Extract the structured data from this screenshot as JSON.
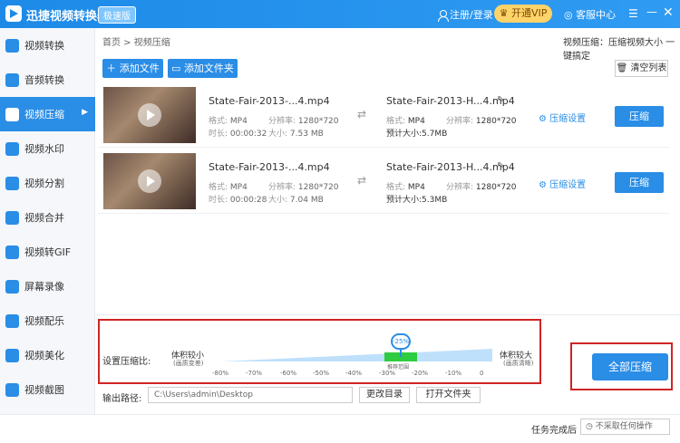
{
  "titlebar": {
    "app_title": "迅捷视频转换器",
    "edition": "极速版",
    "login": "注册/登录",
    "vip": "开通VIP",
    "service": "客服中心",
    "menu_icon": "☰",
    "minimize_icon": "—",
    "close_icon": "✕"
  },
  "sidebar": {
    "items": [
      {
        "label": "视频转换"
      },
      {
        "label": "音频转换"
      },
      {
        "label": "视频压缩"
      },
      {
        "label": "视频水印"
      },
      {
        "label": "视频分割"
      },
      {
        "label": "视频合并"
      },
      {
        "label": "视频转GIF"
      },
      {
        "label": "屏幕录像"
      },
      {
        "label": "视频配乐"
      },
      {
        "label": "视频美化"
      },
      {
        "label": "视频截图"
      }
    ],
    "active_index": 2
  },
  "breadcrumb": "首页 > 视频压缩",
  "top_note": "视频压缩：压缩视频大小 一键搞定",
  "toolbar": {
    "add_file": "＋ 添加文件",
    "add_folder": "添加文件夹",
    "clear_list": "清空列表"
  },
  "files": [
    {
      "name": "State-Fair-2013-...4.mp4",
      "format_label": "格式:",
      "format": "MP4",
      "res_label": "分辨率:",
      "res": "1280*720",
      "duration_label": "时长:",
      "duration": "00:00:32",
      "size_label": "大小:",
      "size": "7.53 MB",
      "out_name": "State-Fair-2013-H...4.mp4",
      "out_format": "MP4",
      "out_res": "1280*720",
      "est_label": "预计大小:",
      "est_size": "5.7MB",
      "settings": "压缩设置",
      "compress": "压缩"
    },
    {
      "name": "State-Fair-2013-...4.mp4",
      "format_label": "格式:",
      "format": "MP4",
      "res_label": "分辨率:",
      "res": "1280*720",
      "duration_label": "时长:",
      "duration": "00:00:28",
      "size_label": "大小:",
      "size": "7.04 MB",
      "out_name": "State-Fair-2013-H...4.mp4",
      "out_format": "MP4",
      "out_res": "1280*720",
      "est_label": "预计大小:",
      "est_size": "5.3MB",
      "settings": "压缩设置",
      "compress": "压缩"
    }
  ],
  "compress_ratio": {
    "label": "设置压缩比:",
    "smaller": "体积较小",
    "smaller_note": "(画质变差)",
    "larger": "体积较大",
    "larger_note": "(画质清晰)",
    "value_label": "-25%",
    "value": -25,
    "recommended": "推荐范围",
    "ticks": [
      "-80%",
      "-70%",
      "-60%",
      "-50%",
      "-40%",
      "-30%",
      "-20%",
      "-10%",
      "0"
    ]
  },
  "output": {
    "label": "输出路径:",
    "path": "C:\\Users\\admin\\Desktop",
    "change_dir": "更改目录",
    "open_folder": "打开文件夹"
  },
  "compress_all": "全部压缩",
  "status": {
    "done_label": "任务完成后",
    "done_option": "不采取任何操作"
  },
  "colors": {
    "accent": "#2a8de6",
    "highlight_border": "#d02424",
    "recommended_range": "#2ecc40"
  }
}
